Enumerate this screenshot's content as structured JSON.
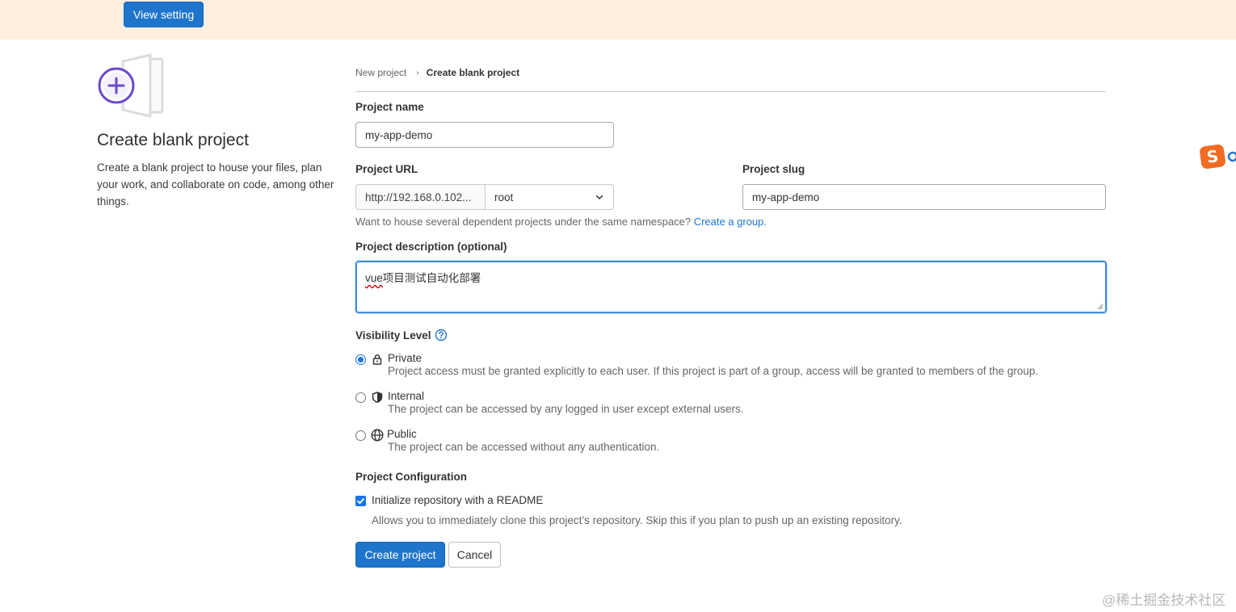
{
  "banner": {
    "view_setting_label": "View setting"
  },
  "sidebar": {
    "title": "Create blank project",
    "description": "Create a blank project to house your files, plan your work, and collaborate on code, among other things."
  },
  "breadcrumb": {
    "parent": "New project",
    "current": "Create blank project"
  },
  "form": {
    "project_name": {
      "label": "Project name",
      "value": "my-app-demo"
    },
    "project_url": {
      "label": "Project URL",
      "prefix": "http://192.168.0.102...",
      "namespace": "root"
    },
    "project_slug": {
      "label": "Project slug",
      "value": "my-app-demo"
    },
    "namespace_hint": {
      "text": "Want to house several dependent projects under the same namespace?",
      "link": "Create a group."
    },
    "description": {
      "label": "Project description (optional)",
      "value_underlined": "vue",
      "value_rest": "项目测试自动化部署"
    },
    "visibility": {
      "label": "Visibility Level",
      "options": [
        {
          "label": "Private",
          "help": "Project access must be granted explicitly to each user. If this project is part of a group, access will be granted to members of the group.",
          "selected": true,
          "icon": "lock-icon"
        },
        {
          "label": "Internal",
          "help": "The project can be accessed by any logged in user except external users.",
          "selected": false,
          "icon": "shield-icon"
        },
        {
          "label": "Public",
          "help": "The project can be accessed without any authentication.",
          "selected": false,
          "icon": "globe-icon"
        }
      ]
    },
    "configuration": {
      "label": "Project Configuration",
      "readme_label": "Initialize repository with a README",
      "readme_checked": true,
      "readme_help": "Allows you to immediately clone this project’s repository. Skip this if you plan to push up an existing repository."
    },
    "create_label": "Create project",
    "cancel_label": "Cancel"
  },
  "watermark": "@稀土掘金技术社区",
  "colors": {
    "primary": "#1f75cb",
    "banner": "#fdefdf",
    "illustration_accent": "#6e49cb"
  }
}
